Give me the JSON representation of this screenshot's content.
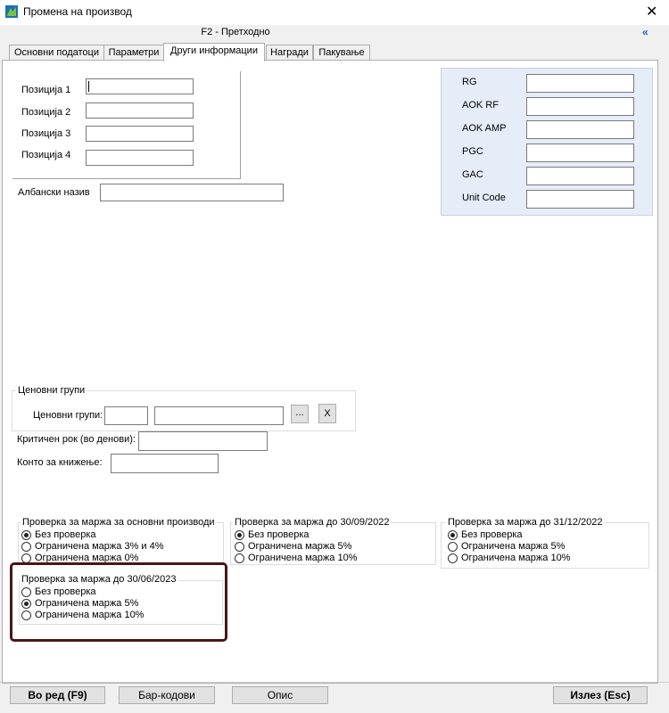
{
  "window": {
    "title": "Промена на производ",
    "close_glyph": "✕",
    "icon": "app-logo-icon"
  },
  "header": {
    "subtitle": "F2 - Претходно",
    "collapse_glyph": "«"
  },
  "tabs": [
    {
      "label": "Основни податоци",
      "active": false
    },
    {
      "label": "Параметри",
      "active": false
    },
    {
      "label": "Други информации",
      "active": true
    },
    {
      "label": "Награди",
      "active": false
    },
    {
      "label": "Пакување",
      "active": false
    }
  ],
  "positions": [
    {
      "label": "Позиција 1",
      "value": ""
    },
    {
      "label": "Позиција 2",
      "value": ""
    },
    {
      "label": "Позиција 3",
      "value": ""
    },
    {
      "label": "Позиција 4",
      "value": ""
    }
  ],
  "albanian": {
    "label": "Албански назив",
    "value": ""
  },
  "right_fields": [
    {
      "label": "RG",
      "value": ""
    },
    {
      "label": "AOK RF",
      "value": ""
    },
    {
      "label": "AOK AMP",
      "value": ""
    },
    {
      "label": "PGC",
      "value": ""
    },
    {
      "label": "GAC",
      "value": ""
    },
    {
      "label": "Unit Code",
      "value": ""
    }
  ],
  "price_groups": {
    "legend": "Ценовни групи",
    "label": "Ценовни групи:",
    "code": "",
    "name": "",
    "browse_label": "...",
    "clear_label": "X"
  },
  "critical": {
    "label": "Критичен рок (во денови):",
    "value": ""
  },
  "account": {
    "label": "Конто за книжење:",
    "value": ""
  },
  "margin_groups": [
    {
      "legend": "Проверка за маржа за основни производи",
      "options": [
        "Без проверка",
        "Ограничена маржа 3% и 4%",
        "Ограничена маржа 0%"
      ],
      "selected": 0
    },
    {
      "legend": "Проверка за маржа до 30/09/2022",
      "options": [
        "Без проверка",
        "Ограничена маржа 5%",
        "Ограничена маржа 10%"
      ],
      "selected": 0
    },
    {
      "legend": "Проверка за маржа до 31/12/2022",
      "options": [
        "Без проверка",
        "Ограничена маржа 5%",
        "Ограничена маржа 10%"
      ],
      "selected": 0
    },
    {
      "legend": "Проверка за маржа до 30/06/2023",
      "options": [
        "Без проверка",
        "Ограничена маржа 5%",
        "Ограничена маржа 10%"
      ],
      "selected": 1
    }
  ],
  "footer": {
    "ok_label": "Во ред (F9)",
    "barcodes_label": "Бар-кодови",
    "description_label": "Опис",
    "exit_label": "Излез (Esc)"
  }
}
